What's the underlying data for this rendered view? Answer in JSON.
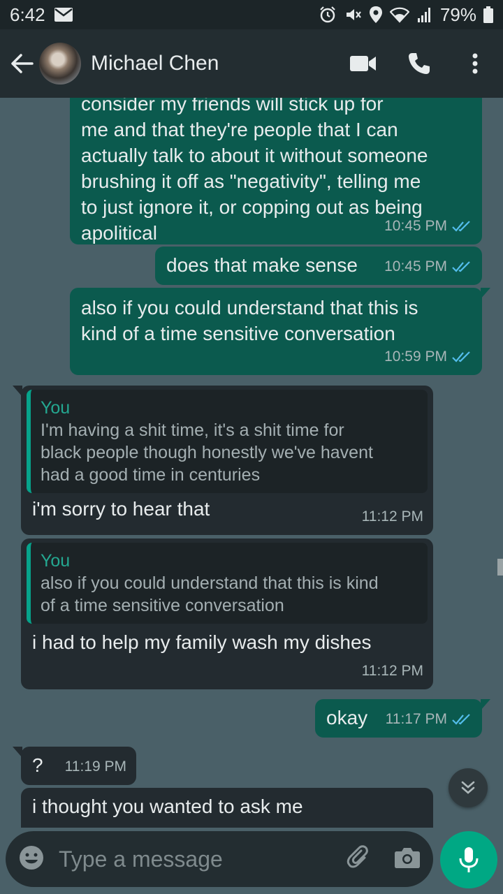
{
  "status_bar": {
    "time": "6:42",
    "battery": "79%"
  },
  "header": {
    "contact_name": "Michael Chen"
  },
  "messages": [
    {
      "direction": "out",
      "text_lines": [
        "consider my friends will stick up for",
        "me and that they're people that I can",
        "actually talk to about it without someone",
        "brushing it off as \"negativity\", telling me",
        "to just ignore it, or copping out as being",
        "apolitical"
      ],
      "time": "10:45 PM",
      "status": "read"
    },
    {
      "direction": "out",
      "text": "does that make sense",
      "time": "10:45 PM",
      "status": "read"
    },
    {
      "direction": "out",
      "text_lines": [
        "also if you could understand that this is",
        "kind of a time sensitive conversation"
      ],
      "time": "10:59 PM",
      "status": "read"
    },
    {
      "direction": "in",
      "quote_author": "You",
      "quote_lines": [
        "I'm having a shit time, it's a shit time for",
        "black people though honestly we've havent",
        "had a good time in centuries"
      ],
      "text": "i'm sorry to hear that",
      "time": "11:12 PM"
    },
    {
      "direction": "in",
      "quote_author": "You",
      "quote_lines": [
        "also if you could understand that this is kind",
        "of a time sensitive conversation"
      ],
      "text": "i had to help my family wash my dishes",
      "time": "11:12 PM"
    },
    {
      "direction": "out",
      "text": "okay",
      "time": "11:17 PM",
      "status": "read"
    },
    {
      "direction": "in",
      "text": "?",
      "time": "11:19 PM"
    },
    {
      "direction": "in",
      "text": "i thought you wanted to ask me",
      "time": ""
    }
  ],
  "input": {
    "placeholder": "Type a message"
  },
  "icons": {
    "back": "arrow-left-icon",
    "video": "video-camera-icon",
    "call": "phone-icon",
    "menu": "more-vertical-icon",
    "emoji": "emoji-icon",
    "attach": "paperclip-icon",
    "camera": "camera-icon",
    "mic": "microphone-icon",
    "scroll_down": "chevron-double-down-icon",
    "read_receipt": "double-check-icon"
  },
  "colors": {
    "outgoing_bubble": "#0b5a4e",
    "incoming_bubble": "#232b30",
    "read_tick": "#53bdeb",
    "accent": "#00a884",
    "quote_bar": "#06a38b"
  }
}
